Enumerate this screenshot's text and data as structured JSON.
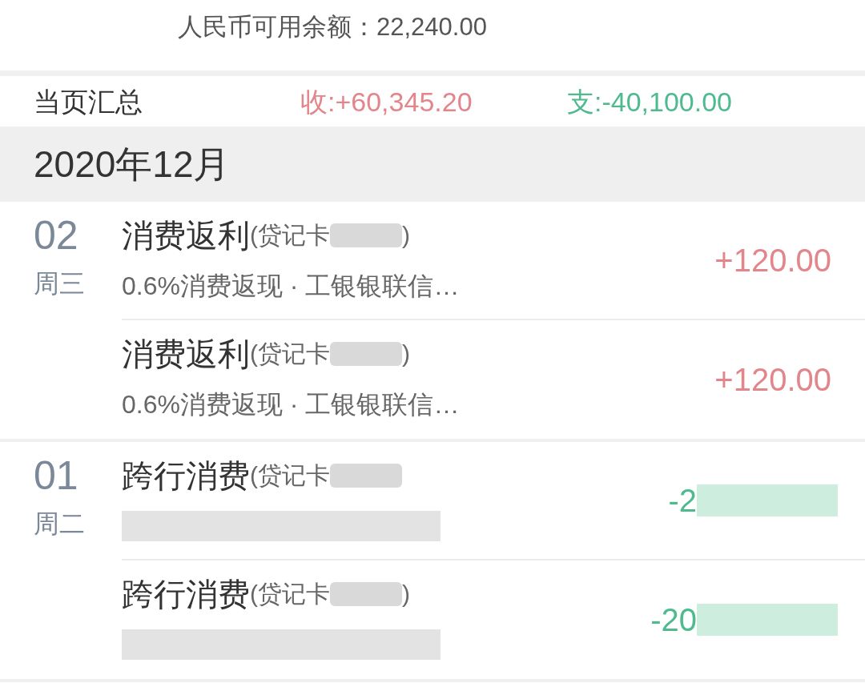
{
  "balance": {
    "text": "人民币可用余额：22,240.00"
  },
  "page_summary": {
    "label": "当页汇总",
    "income": "收:+60,345.20",
    "expense": "支:-40,100.00"
  },
  "month": {
    "label": "2020年12月"
  },
  "days": [
    {
      "day": "02",
      "weekday": "周三",
      "transactions": [
        {
          "title": "消费返利",
          "account": "(贷记卡",
          "account_redacted": true,
          "account_end": ")",
          "detail": "0.6%消费返现 · 工银银联信…",
          "detail_redacted": false,
          "amount": "+120.00",
          "amount_redacted": false,
          "kind": "income"
        },
        {
          "title": "消费返利",
          "account": "(贷记卡",
          "account_redacted": true,
          "account_end": ")",
          "detail": "0.6%消费返现 · 工银银联信…",
          "detail_redacted": false,
          "amount": "+120.00",
          "amount_redacted": false,
          "kind": "income"
        }
      ]
    },
    {
      "day": "01",
      "weekday": "周二",
      "transactions": [
        {
          "title": "跨行消费",
          "account": "(贷记卡",
          "account_redacted": true,
          "detail_redacted": true,
          "amount": "-2",
          "amount_redacted": true,
          "kind": "expense"
        },
        {
          "title": "跨行消费",
          "account": "(贷记卡",
          "account_redacted": true,
          "account_end": ")",
          "detail_redacted": true,
          "amount": "-20",
          "amount_redacted": true,
          "kind": "expense"
        }
      ]
    }
  ]
}
